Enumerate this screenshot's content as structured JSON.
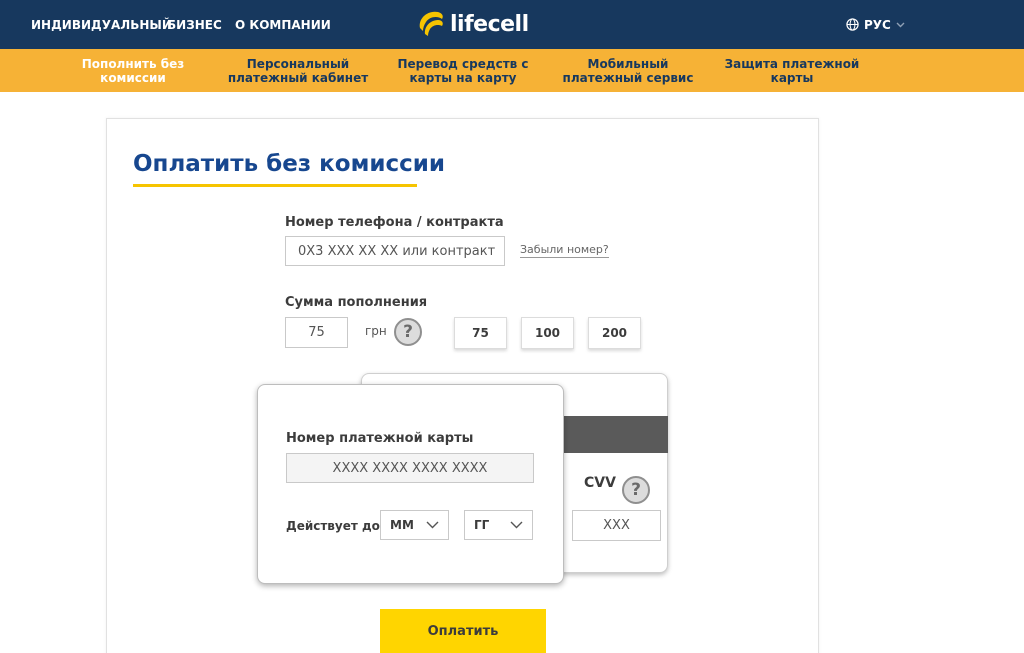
{
  "topnav": {
    "individual": "ИНДИВИДУАЛЬНЫЙ",
    "business": "БИЗНЕС",
    "company": "О КОМПАНИИ",
    "logo": "lifecell",
    "language": "РУС"
  },
  "subnav": [
    {
      "line1": "Пополнить без",
      "line2": "комиссии"
    },
    {
      "line1": "Персональный",
      "line2": "платежный кабинет"
    },
    {
      "line1": "Перевод средств с",
      "line2": "карты на карту"
    },
    {
      "line1": "Мобильный",
      "line2": "платежный сервис"
    },
    {
      "line1": "Защита платежной",
      "line2": "карты"
    }
  ],
  "form": {
    "title": "Оплатить без комиссии",
    "phone_label": "Номер телефона / контракта",
    "phone_placeholder": "0X3 XXX XX XX или контракт",
    "forgot_link": "Забыли номер?",
    "sum_label": "Сумма пополнения",
    "sum_value": "75",
    "currency": "грн",
    "help_symbol": "?",
    "presets": [
      "75",
      "100",
      "200"
    ],
    "card_number_label": "Номер платежной карты",
    "card_number_placeholder": "XXXX XXXX XXXX XXXX",
    "valid_label": "Действует до",
    "month_value": "ММ",
    "year_value": "ГГ",
    "cvv_label": "CVV",
    "cvv_placeholder": "XXX",
    "pay_button": "Оплатить"
  },
  "colors": {
    "topbar": "#17385e",
    "subbar": "#f6b236",
    "title": "#17478f",
    "accent_yellow": "#ffd500"
  }
}
